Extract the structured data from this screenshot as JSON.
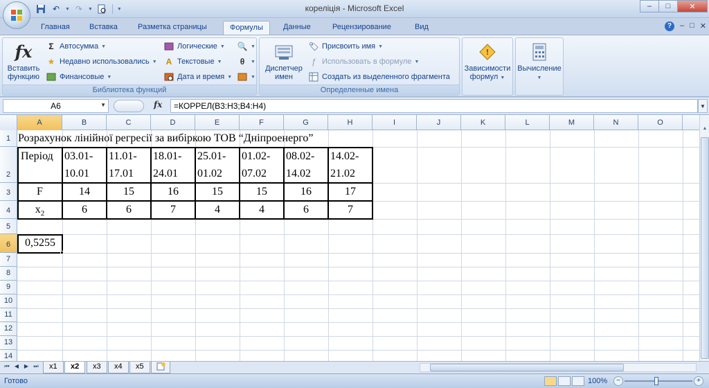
{
  "window": {
    "title": "кореліція - Microsoft Excel",
    "controls": [
      "–",
      "□",
      "✕"
    ]
  },
  "ribbon": {
    "tabs": [
      "Главная",
      "Вставка",
      "Разметка страницы",
      "Формулы",
      "Данные",
      "Рецензирование",
      "Вид"
    ],
    "active_tab": "Формулы",
    "help": "?",
    "sub_controls": [
      "–",
      "□",
      "✕"
    ],
    "function_library": {
      "label": "Библиотека функций",
      "insert_function": "Вставить функцию",
      "insert_function_line1": "Вставить",
      "insert_function_line2": "функцию",
      "autosum": "Автосумма",
      "recent": "Недавно использовались",
      "financial": "Финансовые",
      "logical": "Логические",
      "text": "Текстовые",
      "datetime": "Дата и время"
    },
    "defined_names": {
      "label": "Определенные имена",
      "manager_line1": "Диспетчер",
      "manager_line2": "имен",
      "assign_name": "Присвоить имя",
      "use_in_formula": "Использовать в формуле",
      "create_from_selection": "Создать из выделенного фрагмента"
    },
    "dependencies_line1": "Зависимости",
    "dependencies_line2": "формул",
    "calculation": "Вычисление"
  },
  "formula_bar": {
    "name_box": "A6",
    "fx": "fx",
    "formula": "=КОРРЕЛ(B3:H3;B4:H4)"
  },
  "grid": {
    "columns": [
      "A",
      "B",
      "C",
      "D",
      "E",
      "F",
      "G",
      "H",
      "I",
      "J",
      "K",
      "L",
      "M",
      "N",
      "O"
    ],
    "rows": [
      "1",
      "2",
      "3",
      "4",
      "5",
      "6",
      "7",
      "8",
      "9",
      "10",
      "11",
      "12",
      "13",
      "14"
    ],
    "title": "Розрахунок лінійної регресії за вибіркою ТОВ “Дніпроенерго”",
    "header_label": "Період",
    "periods": [
      [
        "03.01-",
        "10.01"
      ],
      [
        "11.01-",
        "17.01"
      ],
      [
        "18.01-",
        "24.01"
      ],
      [
        "25.01-",
        "01.02"
      ],
      [
        "01.02-",
        "07.02"
      ],
      [
        "08.02-",
        "14.02"
      ],
      [
        "14.02-",
        "21.02"
      ]
    ],
    "row3_label": "F",
    "row3_values": [
      "14",
      "15",
      "16",
      "15",
      "15",
      "16",
      "17"
    ],
    "row4_label": "x",
    "row4_sub": "2",
    "row4_values": [
      "6",
      "6",
      "7",
      "4",
      "4",
      "6",
      "7"
    ],
    "result": "0,5255"
  },
  "sheets": {
    "tabs": [
      "x1",
      "x2",
      "x3",
      "x4",
      "x5"
    ],
    "active": "x2",
    "nav": [
      "⏮",
      "◀",
      "▶",
      "⏭"
    ]
  },
  "status": {
    "text": "Готово",
    "zoom": "100%",
    "zoom_minus": "−",
    "zoom_plus": "+"
  }
}
